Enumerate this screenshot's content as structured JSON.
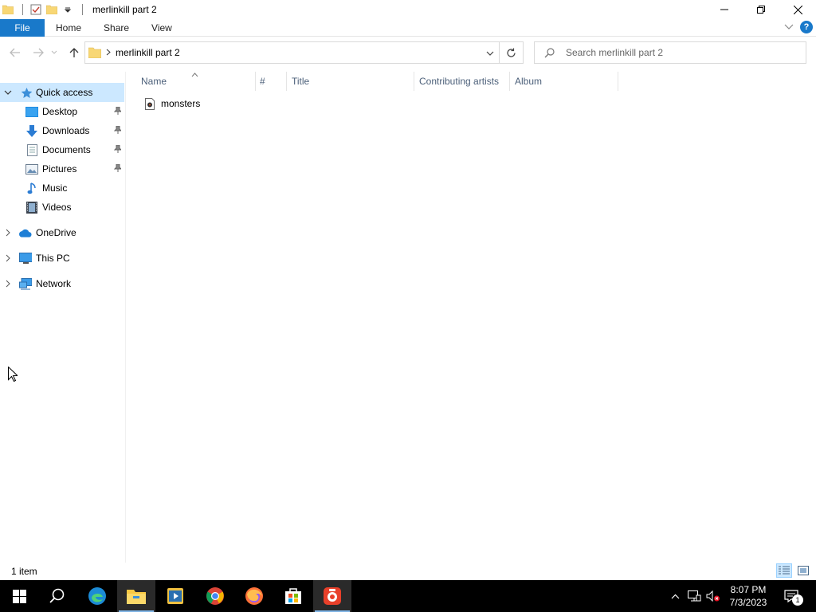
{
  "window": {
    "title": "merlinkill part 2",
    "controls": {
      "minimize": "minimize-icon",
      "restore": "restore-icon",
      "close": "close-icon"
    }
  },
  "ribbon": {
    "tabs": [
      {
        "label": "File"
      },
      {
        "label": "Home"
      },
      {
        "label": "Share"
      },
      {
        "label": "View"
      }
    ]
  },
  "address": {
    "path": "merlinkill part 2",
    "search_placeholder": "Search merlinkill part 2"
  },
  "nav": {
    "quick_access": "Quick access",
    "items": [
      {
        "label": "Desktop",
        "pinned": true
      },
      {
        "label": "Downloads",
        "pinned": true
      },
      {
        "label": "Documents",
        "pinned": true
      },
      {
        "label": "Pictures",
        "pinned": true
      },
      {
        "label": "Music",
        "pinned": false
      },
      {
        "label": "Videos",
        "pinned": false
      }
    ],
    "onedrive": "OneDrive",
    "thispc": "This PC",
    "network": "Network"
  },
  "columns": {
    "name": "Name",
    "number": "#",
    "title": "Title",
    "artists": "Contributing artists",
    "album": "Album"
  },
  "files": [
    {
      "name": "monsters"
    }
  ],
  "status": {
    "count": "1 item"
  },
  "taskbar": {
    "time": "8:07 PM",
    "date": "7/3/2023",
    "notification_count": "1"
  },
  "colors": {
    "accent": "#1979ca",
    "selection": "#cce8ff",
    "header_text": "#4c607a"
  }
}
